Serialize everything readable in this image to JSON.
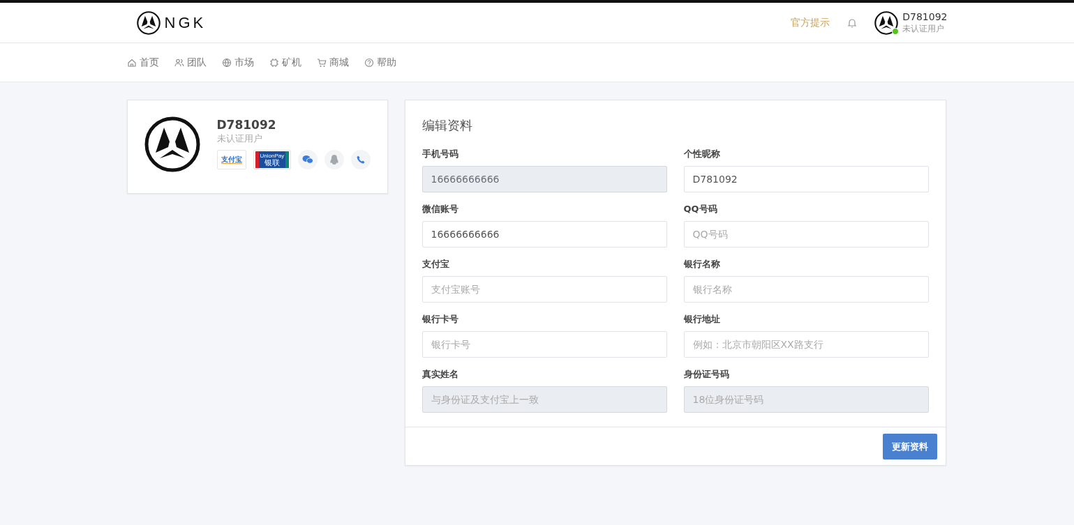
{
  "header": {
    "logo_text": "NGK",
    "notice_link": "官方提示",
    "user": {
      "name": "D781092",
      "status": "未认证用户"
    }
  },
  "nav": [
    {
      "kind": "home",
      "label": "首页"
    },
    {
      "kind": "team",
      "label": "团队"
    },
    {
      "kind": "globe",
      "label": "市场"
    },
    {
      "kind": "chip",
      "label": "矿机"
    },
    {
      "kind": "cart",
      "label": "商城"
    },
    {
      "kind": "help",
      "label": "帮助"
    }
  ],
  "profile_card": {
    "name": "D781092",
    "status": "未认证用户",
    "badges": [
      {
        "kind": "alipay",
        "text": "支付宝"
      },
      {
        "kind": "unionpay",
        "text": "UnionPay",
        "subtext": "银联"
      },
      {
        "kind": "wechat"
      },
      {
        "kind": "qq"
      },
      {
        "kind": "phone"
      }
    ]
  },
  "form": {
    "title": "编辑资料",
    "fields": [
      {
        "label": "手机号码",
        "value": "16666666666",
        "disabled": true
      },
      {
        "label": "个性昵称",
        "value": "D781092",
        "disabled": false
      },
      {
        "label": "微信账号",
        "value": "16666666666",
        "disabled": false
      },
      {
        "label": "QQ号码",
        "placeholder": "QQ号码",
        "disabled": false
      },
      {
        "label": "支付宝",
        "placeholder": "支付宝账号",
        "disabled": false
      },
      {
        "label": "银行名称",
        "placeholder": "银行名称",
        "disabled": false
      },
      {
        "label": "银行卡号",
        "placeholder": "银行卡号",
        "disabled": false
      },
      {
        "label": "银行地址",
        "placeholder": "例如：北京市朝阳区XX路支行",
        "disabled": false
      },
      {
        "label": "真实姓名",
        "placeholder": "与身份证及支付宝上一致",
        "disabled": true
      },
      {
        "label": "身份证号码",
        "placeholder": "18位身份证号码",
        "disabled": true
      }
    ],
    "submit": "更新资料"
  }
}
